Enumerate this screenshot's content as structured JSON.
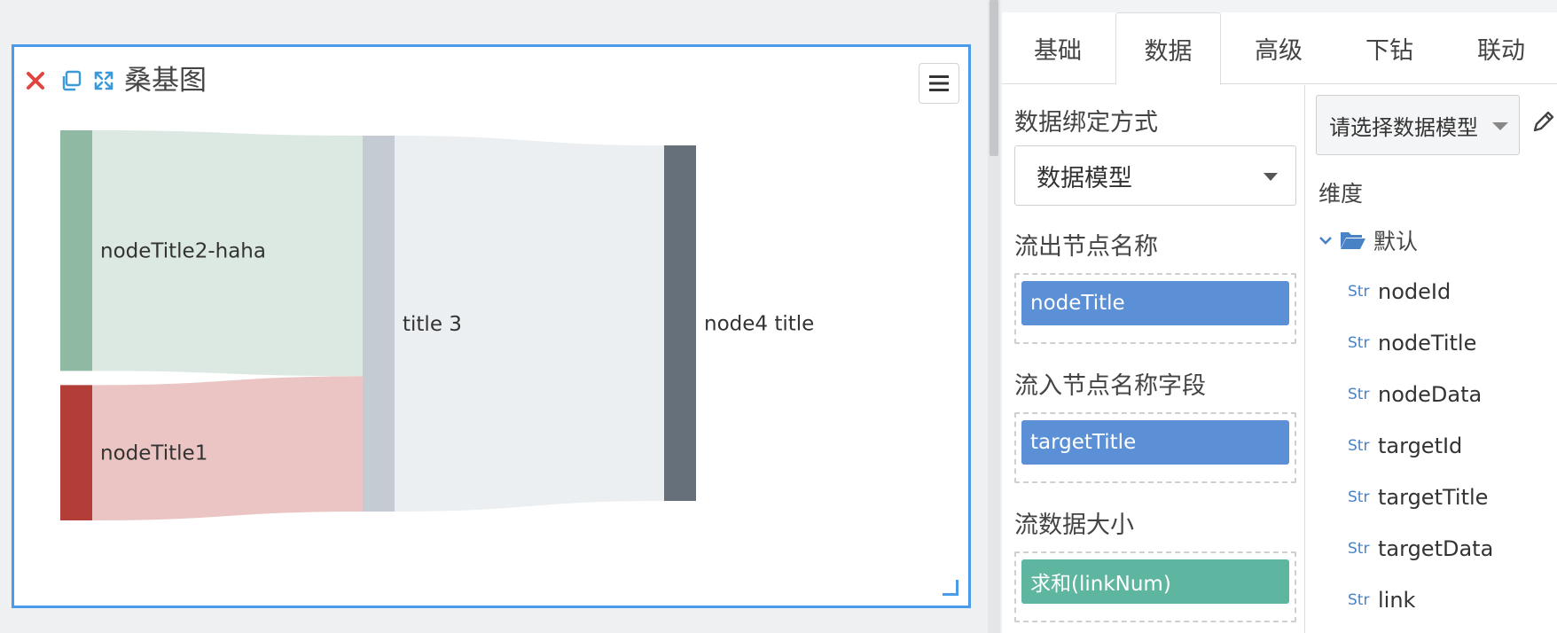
{
  "widget": {
    "title": "桑基图",
    "icons": [
      "close-icon",
      "copy-icon",
      "expand-icon",
      "menu-icon"
    ]
  },
  "chart_data": {
    "type": "sankey",
    "nodes": [
      {
        "name": "nodeTitle2-haha",
        "color": "#8fb9a2"
      },
      {
        "name": "nodeTitle1",
        "color": "#b33d37"
      },
      {
        "name": "title 3",
        "color": "#c4cbd2"
      },
      {
        "name": "node4 title",
        "color": "#65707b"
      }
    ],
    "links": [
      {
        "source": "nodeTitle2-haha",
        "target": "title 3",
        "value": 0.64,
        "color": "#dce8e2"
      },
      {
        "source": "nodeTitle1",
        "target": "title 3",
        "value": 0.36,
        "color": "#eac5c3"
      },
      {
        "source": "title 3",
        "target": "node4 title",
        "value": 1.0,
        "color": "#ebeff1"
      }
    ]
  },
  "panel": {
    "tabs": [
      {
        "label": "基础",
        "active": false
      },
      {
        "label": "数据",
        "active": true
      },
      {
        "label": "高级",
        "active": false
      },
      {
        "label": "下钻",
        "active": false
      },
      {
        "label": "联动",
        "active": false
      }
    ],
    "binding_label": "数据绑定方式",
    "binding_value": "数据模型",
    "source_label": "流出节点名称",
    "source_chip": "nodeTitle",
    "target_label": "流入节点名称字段",
    "target_chip": "targetTitle",
    "size_label": "流数据大小",
    "size_chip": "求和(linkNum)",
    "model_select": "请选择数据模型",
    "dimension_label": "维度",
    "folder": "默认",
    "fields": [
      {
        "type": "Str",
        "name": "nodeId"
      },
      {
        "type": "Str",
        "name": "nodeTitle"
      },
      {
        "type": "Str",
        "name": "nodeData"
      },
      {
        "type": "Str",
        "name": "targetId"
      },
      {
        "type": "Str",
        "name": "targetTitle"
      },
      {
        "type": "Str",
        "name": "targetData"
      },
      {
        "type": "Str",
        "name": "link"
      }
    ]
  }
}
